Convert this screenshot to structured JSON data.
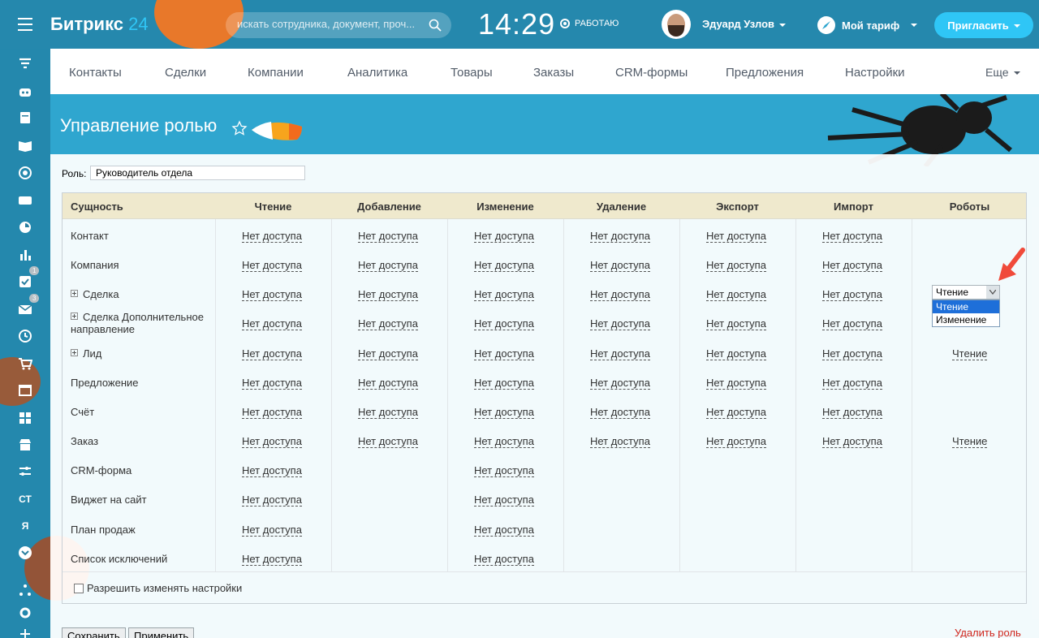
{
  "topbar": {
    "logo_text": "Битрикс",
    "logo_num": "24",
    "search_placeholder": "искать сотрудника, документ, проч...",
    "clock": "14:29",
    "work_status": "РАБОТАЮ",
    "user_name": "Эдуард Узлов",
    "tariff": "Мой тариф",
    "invite": "Пригласить"
  },
  "sidebar": {
    "badges": {
      "tasks": "1",
      "mail": "3"
    },
    "text_items": [
      "СТ",
      "Я"
    ]
  },
  "crm_nav": {
    "items": [
      "Контакты",
      "Сделки",
      "Компании",
      "Аналитика",
      "Товары",
      "Заказы",
      "CRM-формы",
      "Предложения",
      "Настройки"
    ],
    "more": "Еще"
  },
  "page": {
    "title": "Управление ролью"
  },
  "role": {
    "label": "Роль:",
    "value": "Руководитель отдела"
  },
  "table": {
    "columns": [
      "Сущность",
      "Чтение",
      "Добавление",
      "Изменение",
      "Удаление",
      "Экспорт",
      "Импорт",
      "Роботы"
    ],
    "no_access": "Нет доступа",
    "rows": [
      {
        "name": "Контакт"
      },
      {
        "name": "Компания"
      },
      {
        "name": "Сделка"
      },
      {
        "name": "Сделка Дополнительное",
        "name2": "направление"
      },
      {
        "name": "Лид",
        "robots": "Чтение"
      },
      {
        "name": "Предложение"
      },
      {
        "name": "Счёт"
      },
      {
        "name": "Заказ",
        "robots": "Чтение"
      },
      {
        "name": "CRM-форма"
      },
      {
        "name": "Виджет на сайт"
      },
      {
        "name": "План продаж"
      },
      {
        "name": "Список исключений"
      }
    ],
    "allow_settings": "Разрешить изменять настройки"
  },
  "dropdown": {
    "selected": "Чтение",
    "options": [
      "Чтение",
      "Изменение"
    ]
  },
  "buttons": {
    "save": "Сохранить",
    "apply": "Применить",
    "delete_role": "Удалить роль"
  },
  "colors": {
    "accent": "#2fc6f6",
    "danger": "#d0261d",
    "header_bg": "#eee5c4"
  }
}
